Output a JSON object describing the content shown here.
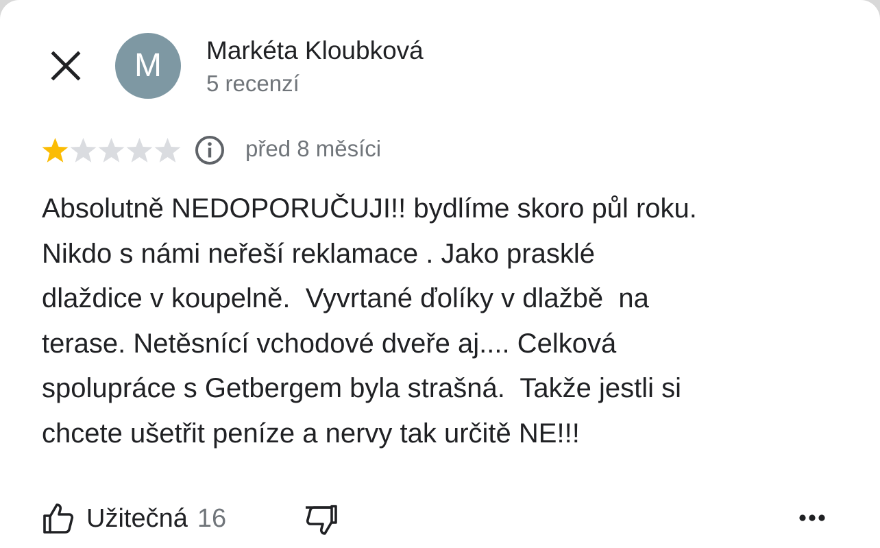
{
  "author": {
    "name": "Markéta Kloubková",
    "initial": "M",
    "avatar_color": "#7e98a3",
    "reviews_count_label": "5 recenzí"
  },
  "review": {
    "rating": 1,
    "max_rating": 5,
    "star_filled_color": "#fbbc04",
    "star_empty_color": "#dadce0",
    "date": "před 8 měsíci",
    "text": "Absolutně NEDOPORUČUJI!! bydlíme skoro půl roku.\nNikdo s námi neřeší reklamace . Jako prasklé\ndlaždice v koupelně.  Vyvrtané ďolíky v dlažbě  na\nterase. Netěsnící vchodové dveře aj.... Celková\nspolupráce s Getbergem byla strašná.  Takže jestli si\nchcete ušetřit peníze a nervy tak určitě NE!!!"
  },
  "actions": {
    "helpful_label": "Užitečná",
    "helpful_count": "16"
  },
  "icons": {
    "close": "close-icon",
    "info": "info-icon",
    "thumbs_up": "thumbs-up-icon",
    "thumbs_down": "thumbs-down-icon",
    "more": "more-horizontal-icon"
  }
}
